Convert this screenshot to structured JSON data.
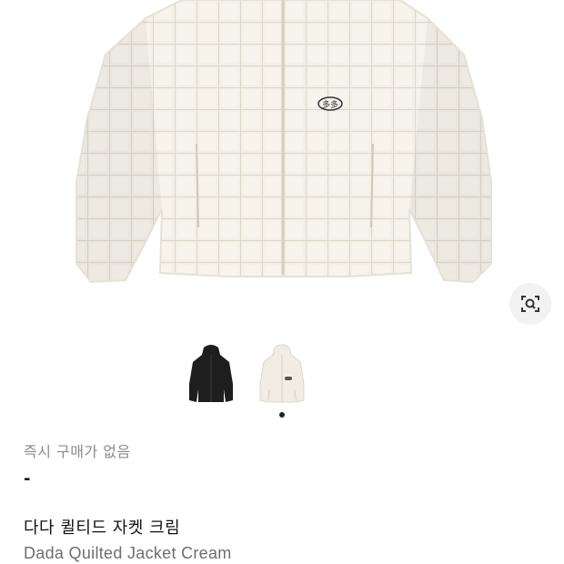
{
  "product": {
    "image_alt_icon": "quilted-jacket-image",
    "lens_icon": "visual-search-icon",
    "thumbnails": [
      {
        "color_name": "black",
        "fill": "#1e1e1e"
      },
      {
        "color_name": "cream",
        "fill": "#f2ede4"
      }
    ],
    "selected_thumbnail": 1,
    "instant_purchase_label": "즉시 구매가 없음",
    "price": "-",
    "name_ko": "다다 퀼티드 자켓 크림",
    "name_en": "Dada Quilted Jacket Cream"
  },
  "colors": {
    "jacket": "#f4f0e8",
    "quilt_line": "#ddd7cb",
    "muted_text": "#8b8b8b",
    "title_en": "#6e6e6e"
  }
}
